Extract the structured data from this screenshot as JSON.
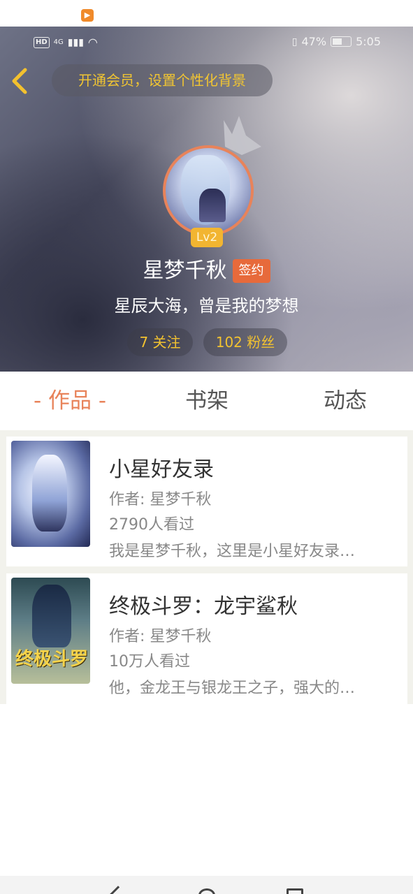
{
  "status_bar": {
    "network": "4G",
    "battery": "47%",
    "time": "5:05"
  },
  "header": {
    "vip_banner": "开通会员，设置个性化背景",
    "level": "Lv2",
    "user_name": "星梦千秋",
    "sign_badge": "签约",
    "motto": "星辰大海，曾是我的梦想",
    "following": "7 关注",
    "fans": "102 粉丝"
  },
  "tabs": [
    {
      "label": "- 作品 -",
      "active": true
    },
    {
      "label": "书架",
      "active": false
    },
    {
      "label": "动态",
      "active": false
    }
  ],
  "books": [
    {
      "title": "小星好友录",
      "author": "作者: 星梦千秋",
      "views": "2790人看过",
      "desc": "我是星梦千秋，这里是小星好友录…"
    },
    {
      "title": "终极斗罗：龙宇鲨秋",
      "author": "作者: 星梦千秋",
      "views": "10万人看过",
      "desc": "他，金龙王与银龙王之子，强大的…",
      "cover_text": "终极斗罗"
    }
  ],
  "colors": {
    "accent": "#e8835a",
    "gold": "#f2c230",
    "badge": "#e76a3b"
  }
}
